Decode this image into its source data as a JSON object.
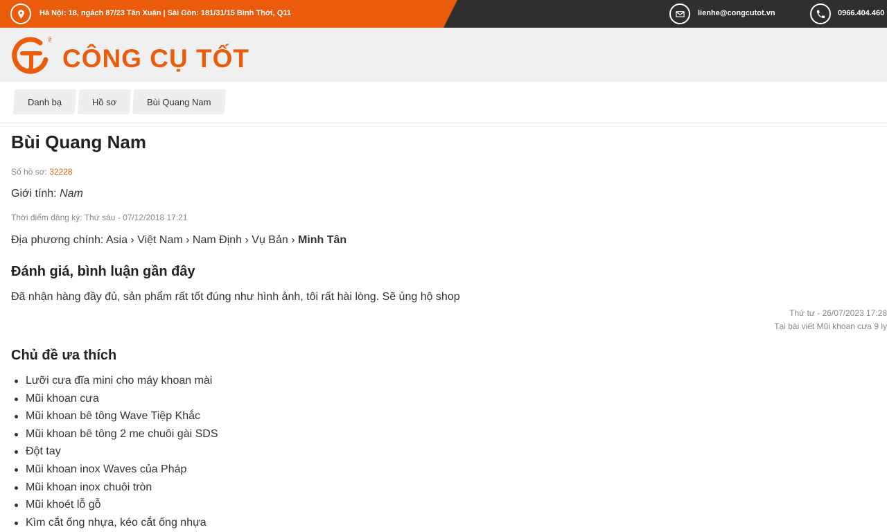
{
  "topbar": {
    "address": "Hà Nội: 18, ngách 87/23 Tân Xuân | Sài Gòn: 181/31/15 Bình Thới, Q11",
    "email": "lienhe@congcutot.vn",
    "phone": "0966.404.460"
  },
  "header": {
    "logo_text": "CÔNG CỤ TỐT",
    "registered_mark": "®"
  },
  "breadcrumb": [
    {
      "label": "Danh bạ"
    },
    {
      "label": "Hồ sơ"
    },
    {
      "label": "Bùi Quang Nam"
    }
  ],
  "profile": {
    "name": "Bùi Quang Nam",
    "id_label": "Số hồ sơ: ",
    "id_value": "32228",
    "gender_label": "Giới tính: ",
    "gender_value": "Nam",
    "registered": "Thời điểm đăng ký: Thứ sáu - 07/12/2018 17:21",
    "location_label": "Địa phương chính: ",
    "location_path": "Asia › Việt Nam › Nam Định › Vụ Bản › ",
    "location_last": "Minh Tân"
  },
  "reviews": {
    "title": "Đánh giá, bình luận gần đây",
    "items": [
      {
        "text": "Đã nhận hàng đầy đủ, sản phẩm rất tốt đúng như hình ảnh, tôi rất hài lòng. Sẽ ủng hộ shop",
        "date": "Thứ tư - 26/07/2023 17:28",
        "source": "Tại bài viết Mũi khoan cưa 9 ly"
      }
    ]
  },
  "topics": {
    "title": "Chủ đề ưa thích",
    "items": [
      "Lưỡi cưa đĩa mini cho máy khoan mài",
      "Mũi khoan cưa",
      "Mũi khoan bê tông Wave Tiệp Khắc",
      "Mũi khoan bê tông 2 me chuôi gài SDS",
      "Đột tay",
      "Mũi khoan inox Waves của Pháp",
      "Mũi khoan inox chuôi tròn",
      "Mũi khoét lỗ gỗ",
      "Kìm cắt ống nhựa, kéo cắt ống nhựa"
    ]
  },
  "colors": {
    "brand": "#ea5b0c",
    "topbar_dark": "#2f2f2f",
    "header_bg": "#f0f0f0"
  },
  "icons": {
    "address": "map-pin-icon",
    "email": "envelope-icon",
    "phone": "phone-icon"
  }
}
